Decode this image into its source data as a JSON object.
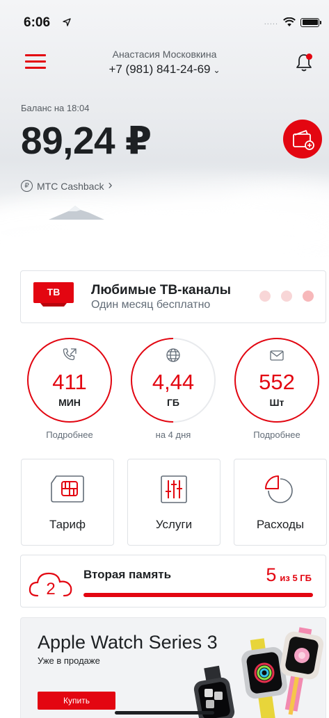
{
  "status_bar": {
    "time": "6:06",
    "location_arrow": "➤",
    "signal": "....."
  },
  "header": {
    "account_name": "Анастасия Московкина",
    "phone": "+7 (981) 841-24-69",
    "chevron": "⌄"
  },
  "balance": {
    "caption": "Баланс на 18:04",
    "value": "89,24 ₽"
  },
  "cashback": {
    "label": "МТС Cashback",
    "chevron": "›",
    "icon_glyph": "₽"
  },
  "promo": {
    "badge": "ТВ",
    "title": "Любимые ТВ-каналы",
    "subtitle": "Один месяц бесплатно",
    "pages": 3,
    "active_page": 3
  },
  "counters": [
    {
      "id": "minutes",
      "icon": "phone-outgoing-icon",
      "value": "411",
      "unit": "МИН",
      "caption": "Подробнее",
      "fill": 1.0
    },
    {
      "id": "internet",
      "icon": "globe-icon",
      "value": "4,44",
      "unit": "ГБ",
      "caption": "на 4 дня",
      "fill": 0.5
    },
    {
      "id": "sms",
      "icon": "envelope-icon",
      "value": "552",
      "unit": "Шт",
      "caption": "Подробнее",
      "fill": 1.0
    }
  ],
  "tiles": [
    {
      "id": "tariff",
      "icon": "sim-card-icon",
      "label": "Тариф"
    },
    {
      "id": "services",
      "icon": "sliders-icon",
      "label": "Услуги"
    },
    {
      "id": "expenses",
      "icon": "pie-chart-icon",
      "label": "Расходы"
    }
  ],
  "storage": {
    "title": "Вторая память",
    "used": "5",
    "total_label": "из 5 ГБ",
    "fill": 1.0
  },
  "ad": {
    "title": "Apple Watch Series 3",
    "subtitle": "Уже в продаже",
    "button": "Купить"
  },
  "colors": {
    "accent": "#e30611",
    "text": "#1d2023",
    "secondary": "#626c77",
    "border": "#dfe2e6"
  }
}
